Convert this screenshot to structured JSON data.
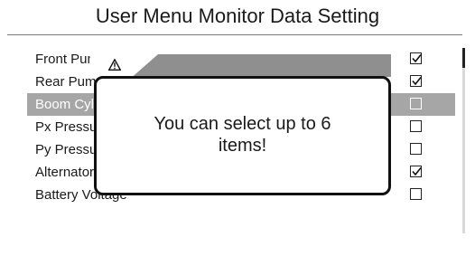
{
  "title": "User Menu Monitor Data Setting",
  "items": [
    {
      "label": "Front Pump Pressure",
      "checked": true,
      "selected": false
    },
    {
      "label": "Rear Pump Pressure",
      "checked": true,
      "selected": false
    },
    {
      "label": "Boom Cylinder Bottom Pressure",
      "checked": false,
      "selected": true
    },
    {
      "label": "Px Pressure",
      "checked": false,
      "selected": false
    },
    {
      "label": "Py Pressure",
      "checked": false,
      "selected": false
    },
    {
      "label": "Alternator Voltage",
      "checked": true,
      "selected": false
    },
    {
      "label": "Battery Voltage",
      "checked": false,
      "selected": false
    }
  ],
  "dialog": {
    "icon": "warning-icon",
    "message_line1": "You can select up to 6",
    "message_line2": "items!"
  },
  "colors": {
    "selected_row": "#a6a6a6",
    "dialog_header": "#8f8f8f"
  }
}
